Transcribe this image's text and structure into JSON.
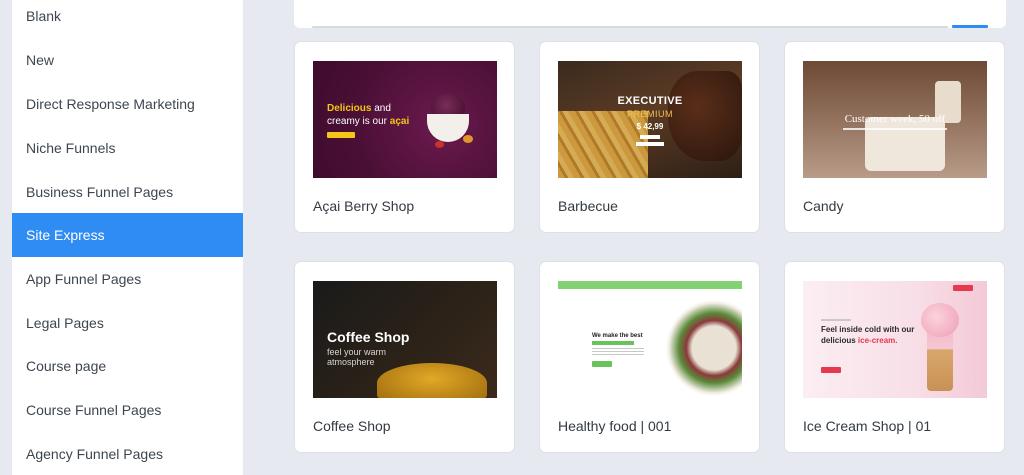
{
  "sidebar": {
    "items": [
      {
        "label": "Blank",
        "active": false
      },
      {
        "label": "New",
        "active": false
      },
      {
        "label": "Direct Response Marketing",
        "active": false
      },
      {
        "label": "Niche Funnels",
        "active": false
      },
      {
        "label": "Business Funnel Pages",
        "active": false
      },
      {
        "label": "Site Express",
        "active": true
      },
      {
        "label": "App Funnel Pages",
        "active": false
      },
      {
        "label": "Legal Pages",
        "active": false
      },
      {
        "label": "Course page",
        "active": false
      },
      {
        "label": "Course Funnel Pages",
        "active": false
      },
      {
        "label": "Agency Funnel Pages",
        "active": false
      }
    ]
  },
  "templates": [
    {
      "label": "Açai Berry Shop",
      "thumb": {
        "line1_highlight": "Delicious",
        "line1_rest": " and",
        "line2_rest": "creamy is our ",
        "line2_highlight": "açai"
      }
    },
    {
      "label": "Barbecue",
      "thumb": {
        "title": "EXECUTIVE",
        "subtitle": "PREMIUM",
        "price": "$ 42,99"
      }
    },
    {
      "label": "Candy",
      "thumb": {
        "headline": "Customer week, 50 off"
      }
    },
    {
      "label": "Coffee Shop",
      "thumb": {
        "title": "Coffee Shop",
        "tagline": "feel your warm atmosphere"
      }
    },
    {
      "label": "Healthy food | 001",
      "thumb": {
        "headline": "We make the best"
      }
    },
    {
      "label": "Ice Cream Shop | 01",
      "thumb": {
        "line1": "Feel inside cold with our",
        "line2_rest": "delicious ",
        "line2_highlight": "ice-cream."
      }
    }
  ],
  "colors": {
    "accent": "#2f8cf2",
    "background": "#e6e9ef",
    "card": "#ffffff"
  }
}
